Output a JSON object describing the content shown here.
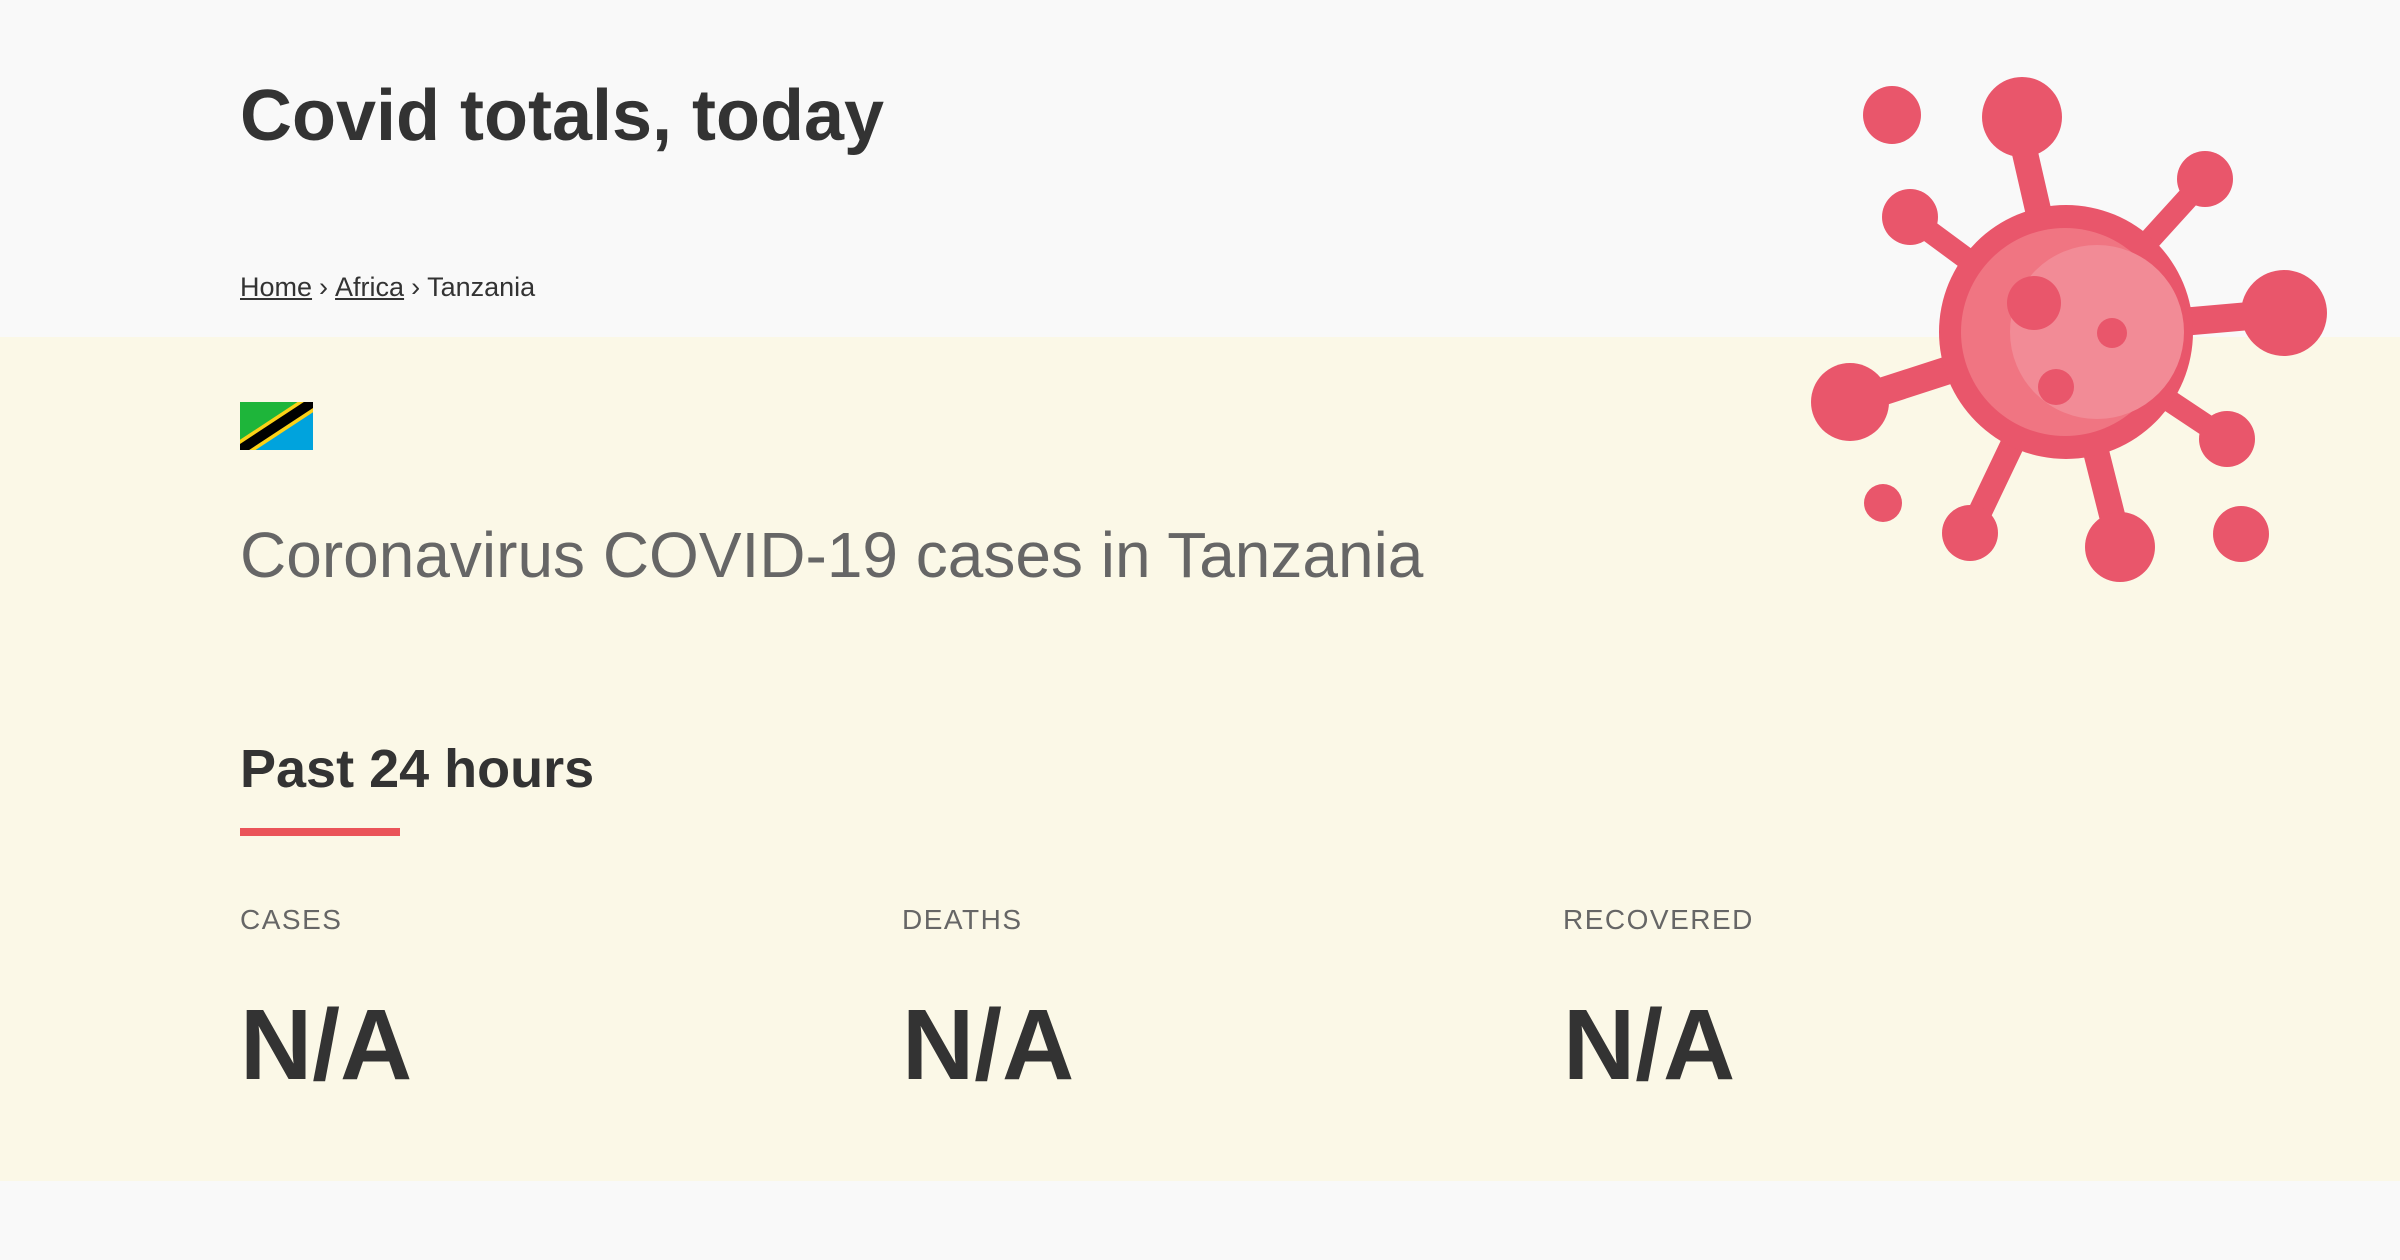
{
  "site": {
    "title": "Covid totals, today"
  },
  "breadcrumb": {
    "items": [
      {
        "label": "Home",
        "link": true
      },
      {
        "label": "Africa",
        "link": true
      },
      {
        "label": "Tanzania",
        "link": false
      }
    ],
    "separator": "›"
  },
  "country": {
    "flag_icon": "tanzania-flag-icon",
    "heading": "Coronavirus COVID-19 cases in Tanzania"
  },
  "section": {
    "title": "Past 24 hours"
  },
  "stats": [
    {
      "label": "CASES",
      "value": "N/A"
    },
    {
      "label": "DEATHS",
      "value": "N/A"
    },
    {
      "label": "RECOVERED",
      "value": "N/A"
    }
  ],
  "decoration": {
    "icon": "virus-icon"
  },
  "colors": {
    "accent": "#ea5459",
    "content_background": "#fbf8e7",
    "page_background": "#f9f9f9",
    "virus_body": "#e9566b",
    "virus_highlight": "#f28b96"
  }
}
